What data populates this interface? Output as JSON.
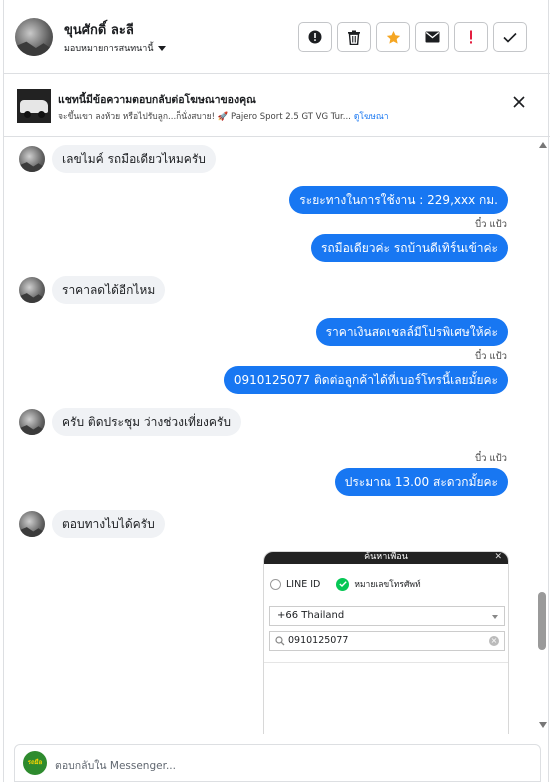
{
  "header": {
    "contact_name": "ขุนศักดิ์ ละลี",
    "assign_label": "มอบหมายการสนทนานี้",
    "actions": [
      {
        "icon": "alert-circle-icon",
        "tooltip": ""
      },
      {
        "icon": "trash-icon",
        "tooltip": ""
      },
      {
        "icon": "star-icon",
        "tooltip": ""
      },
      {
        "icon": "envelope-icon",
        "tooltip": ""
      },
      {
        "icon": "exclamation-icon",
        "tooltip": ""
      },
      {
        "icon": "checkmark-icon",
        "tooltip": ""
      }
    ]
  },
  "ad": {
    "title": "แชทนี้มีข้อความตอบกลับต่อโฆษณาของคุณ",
    "subtitle": "จะขึ้นเขา ลงห้วย หรือไปรับลูก...ก็นั่งสบาย! 🚀 Pajero Sport 2.5 GT VG Tur...",
    "link": "ดูโฆษณา"
  },
  "messages": [
    {
      "side": "in",
      "text": "เลขไมค์ รถมือเดียวไหมครับ"
    },
    {
      "side": "out",
      "text": "ระยะทางในการใช้งาน :     229,xxx กม."
    },
    {
      "side": "out",
      "text": "รถมือเดียวค่ะ  รถบ้านดีเทิร์นเข้าค่ะ"
    },
    {
      "side": "in",
      "text": "ราคาลดได้อีกไหม"
    },
    {
      "side": "out",
      "text": "ราคาเงินสดเชลล์มีโปรพิเศษให้ค่ะ"
    },
    {
      "side": "out",
      "text": "0910125077  ติดต่อลูกค้าได้ที่เบอร์โทรนี้เลยมั้ยคะ"
    },
    {
      "side": "in",
      "text": "ครับ ติดประชุม ว่างช่วงเที่ยงครับ"
    },
    {
      "side": "out",
      "text": "ประมาณ 13.00 สะดวกมั้ยคะ"
    },
    {
      "side": "in",
      "text": "ตอบทางไบได้ครับ"
    }
  ],
  "seen_label": "บี๋ว แป้ว",
  "attachment": {
    "header": "ค้นหาเพื่อน",
    "option_line_id": "LINE ID",
    "option_phone": "หมายเลขโทรศัพท์",
    "country": "+66  Thailand",
    "phone_value": "0910125077"
  },
  "composer": {
    "placeholder": "ตอบกลับใน Messenger...",
    "page_avatar_text": "รถมือสอง"
  },
  "colors": {
    "accent": "#1877f2",
    "incoming_bubble": "#f0f2f5",
    "star": "#f5a623",
    "danger": "#e41e3f",
    "line_green": "#06c755"
  }
}
